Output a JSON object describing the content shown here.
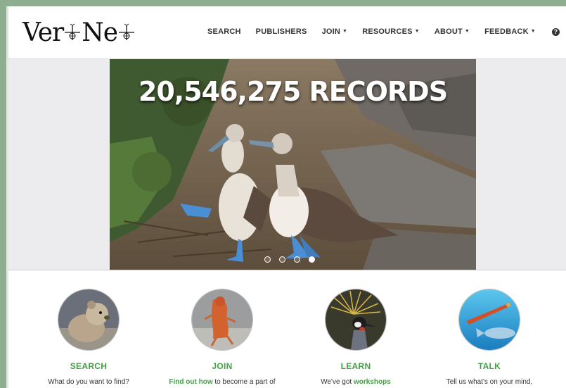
{
  "header": {
    "logo_text_left": "Ver",
    "logo_text_right": "Ne",
    "nav": [
      {
        "label": "SEARCH",
        "dropdown": false
      },
      {
        "label": "PUBLISHERS",
        "dropdown": false
      },
      {
        "label": "JOIN",
        "dropdown": true
      },
      {
        "label": "RESOURCES",
        "dropdown": true
      },
      {
        "label": "ABOUT",
        "dropdown": true
      },
      {
        "label": "FEEDBACK",
        "dropdown": true
      }
    ],
    "help_icon": "question-circle-icon"
  },
  "hero": {
    "title": "20,546,275 RECORDS",
    "slides": 4,
    "active_slide": 4
  },
  "features": [
    {
      "title": "SEARCH",
      "text": "What do you want to find?",
      "link": "",
      "icon": "pika-photo"
    },
    {
      "title": "JOIN",
      "text": " to become a part of",
      "link": "Find out how",
      "icon": "lizard-photo"
    },
    {
      "title": "LEARN",
      "text": "We've got ",
      "link": "workshops",
      "icon": "crowned-crane-photo"
    },
    {
      "title": "TALK",
      "text": "Tell us what's on your mind,",
      "link": "",
      "icon": "sea-creatures-photo"
    }
  ],
  "colors": {
    "accent": "#43a047",
    "frame": "#8fae8f",
    "nav_text": "#333333"
  }
}
